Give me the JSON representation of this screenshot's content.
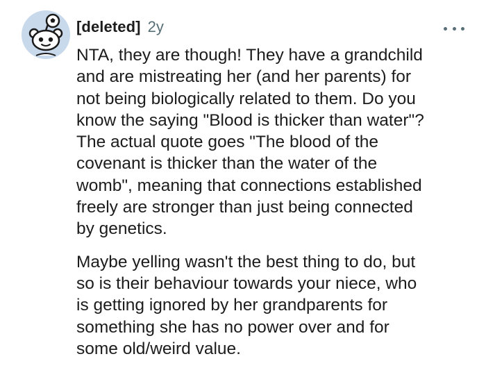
{
  "comment": {
    "username": "[deleted]",
    "age": "2y",
    "paragraphs": [
      "NTA, they are though! They have a grandchild\nand are mistreating her (and her parents) for\nnot being biologically related to them. Do you\nknow the saying \"Blood is thicker than water\"?\nThe actual quote goes \"The blood of the\ncovenant is thicker than the water of the\nwomb\", meaning that connections established\nfreely are stronger than just being connected\nby genetics.",
      "Maybe yelling wasn't the best thing to do, but\nso is their behaviour towards your niece, who\nis getting ignored by her grandparents for\nsomething she has no power over and for\nsome old/weird value."
    ]
  },
  "icons": {
    "avatar": "snoo-avatar-icon",
    "more": "more-options-icon"
  },
  "colors": {
    "avatar_bg": "#c8d9ec",
    "text": "#1c1c1c",
    "meta": "#576f76"
  }
}
